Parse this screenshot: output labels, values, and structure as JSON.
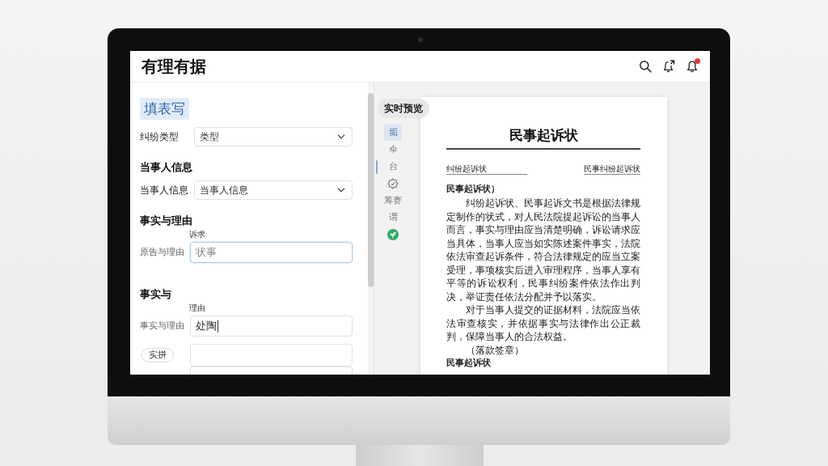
{
  "header": {
    "title": "有理有据",
    "notification_unread": true
  },
  "form": {
    "items": [
      {
        "kind": "tab",
        "label": "填表写",
        "selected": true
      },
      {
        "kind": "select",
        "label": "纠纷类型",
        "value": "类型"
      },
      {
        "kind": "heading",
        "text": "当事人信息"
      },
      {
        "kind": "select",
        "label": "当事人信息",
        "value": "当事人信息"
      },
      {
        "kind": "heading",
        "text": "事实与理由"
      },
      {
        "kind": "input",
        "caption": "诉求",
        "label": "原告与理由",
        "placeholder": "状事",
        "focused": true,
        "cursor": false
      },
      {
        "kind": "heading",
        "text": "事实与"
      },
      {
        "kind": "input",
        "caption": "理由",
        "label": "事实与理由",
        "value": "处陶",
        "focused": false,
        "cursor": true
      },
      {
        "kind": "textarea",
        "button": "实拼"
      },
      {
        "kind": "textarea"
      }
    ]
  },
  "preview": {
    "label": "实时预览",
    "rail": [
      {
        "kind": "glyph",
        "label": "垢",
        "selected": true
      },
      {
        "kind": "glyph",
        "label": "伞",
        "selected": false
      },
      {
        "kind": "glyph",
        "label": "台",
        "selected": false
      },
      {
        "kind": "rosette",
        "selected": false
      },
      {
        "kind": "glyph",
        "label": "筹赛",
        "selected": false
      },
      {
        "kind": "glyph",
        "label": "谓",
        "selected": false
      },
      {
        "kind": "sprout",
        "selected": false
      }
    ],
    "document": {
      "title": "民事起诉状",
      "fields": [
        "纠纷起诉状",
        "民事纠纷起诉状"
      ],
      "heading": "民事起诉状）",
      "paragraphs": [
        "纠纷起诉状、民事起诉文书是根据法律规定制作的状式，对人民法院提起诉讼的当事人而言，事实与理由应当清楚明确，诉讼请求应当具体，当事人应当如实陈述案件事实，法院依法审查起诉条件，符合法律规定的应当立案受理，事项核实后进入审理程序，当事人享有平等的诉讼权利，民事纠纷案件依法作出判决，举证责任依法分配并予以落实。",
        "对于当事人提交的证据材料，法院应当依法审查核实，并依据事实与法律作出公正裁判，保障当事人的合法权益。"
      ],
      "closing": "（落款签章）",
      "footer": "民事起诉状"
    }
  }
}
